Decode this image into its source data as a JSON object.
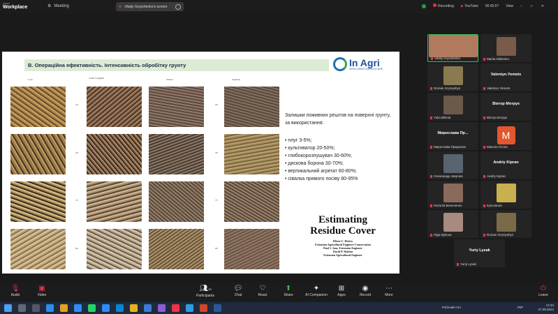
{
  "app": {
    "brand_top": "zoom",
    "brand_bottom": "Workplace",
    "meeting_label": "Meeting"
  },
  "share_tab": {
    "label": "Vitaliy Gryschenko's screen"
  },
  "status": {
    "recording": "Recording",
    "youtube": "YouTube",
    "timer": "00:42:07",
    "view": "View"
  },
  "slide": {
    "header": "B. Операційна ефективність. Інтенсивність обробітку грунту",
    "brand": "In Agri",
    "brand_sub": "INTELLIGENT AGRICULTURE",
    "columns": [
      "Corn",
      "Grain Sorghum",
      "Wheat",
      "Soybean"
    ],
    "percent_labels": [
      "20",
      "30",
      "75",
      "90"
    ],
    "text_intro": "Залишки поживних рештов на поверхні грунту, за використання:",
    "bullets": [
      "плуг 3-5%;",
      "культиватор 20-50%;",
      "глибокорозпушувач 30-60%;",
      "дискова борона 30-70%;",
      "вертикальний агрегат 60-80%;",
      "сівалка прямого посіву 80-95%"
    ],
    "book_title_1": "Estimating",
    "book_title_2": "Residue Cover",
    "book_authors": [
      "Elbert C. Dickey",
      "Extension Agricultural Engineer-Conservation",
      "Paul J. Jasa, Extension Engineer",
      "David P. Shelton",
      "Extension Agricultural Engineer"
    ]
  },
  "participants": [
    {
      "label": "Vitaliy Gryschenko",
      "type": "video",
      "color": "#b07a5e"
    },
    {
      "label": "Mariia Nikitenko",
      "type": "video",
      "color": "#7a5a48"
    },
    {
      "label": "Roman Gryniyshyn",
      "type": "video",
      "color": "#8a7a50"
    },
    {
      "label": "Valentyn.Yemets",
      "type": "name",
      "name": "Valentyn.Yemets"
    },
    {
      "label": "Yulia Blisnia",
      "type": "video",
      "color": "#6a5a4a"
    },
    {
      "label": "Віктор Мотрук",
      "type": "name",
      "name": "Віктор Мотрук"
    },
    {
      "label": "Мирослава Предолюк",
      "type": "name",
      "name": "Мирослава Пр..."
    },
    {
      "label": "Микола Остап",
      "type": "avatar",
      "letter": "M"
    },
    {
      "label": "Олександр Аверчев",
      "type": "video",
      "color": "#5a6470"
    },
    {
      "label": "Andriy Kipran",
      "type": "name",
      "name": "Andriy Kipran"
    },
    {
      "label": "Наталія Басюченко",
      "type": "video",
      "color": "#8a6a5a"
    },
    {
      "label": "Кульчанов",
      "type": "video",
      "color": "#c8b050"
    },
    {
      "label": "Olga Bykova",
      "type": "video",
      "color": "#a88a80"
    },
    {
      "label": "Roman Gryniyshyn",
      "type": "video",
      "color": "#7a6a48"
    },
    {
      "label": "Yuriy Lysak",
      "type": "name",
      "name": "Yuriy Lysak"
    }
  ],
  "toolbar": {
    "audio": "Audio",
    "video": "Video",
    "participants": "Participants",
    "participants_count": "15",
    "chat": "Chat",
    "react": "React",
    "share": "Share",
    "ai": "AI Companion",
    "apps": "Apps",
    "record": "Record",
    "more": "More",
    "leave": "Leave"
  },
  "taskbar": {
    "desktop_label": "Робочий стіл",
    "lang": "УКР",
    "time": "17:34",
    "date": "27.08.2024"
  }
}
